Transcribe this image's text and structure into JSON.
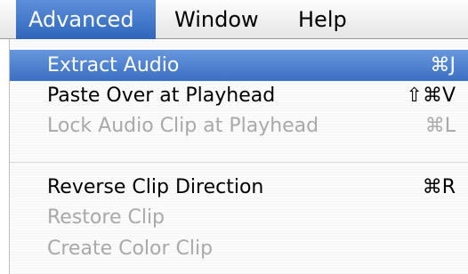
{
  "menubar": {
    "items": [
      {
        "label": "Advanced"
      },
      {
        "label": "Window"
      },
      {
        "label": "Help"
      }
    ]
  },
  "menu": {
    "items": [
      {
        "label": "Extract Audio",
        "shortcut": "⌘J"
      },
      {
        "label": "Paste Over at Playhead",
        "shortcut": "⇧⌘V"
      },
      {
        "label": "Lock Audio Clip at Playhead",
        "shortcut": "⌘L"
      },
      {
        "label": "Reverse Clip Direction",
        "shortcut": "⌘R"
      },
      {
        "label": "Restore Clip",
        "shortcut": ""
      },
      {
        "label": "Create Color Clip",
        "shortcut": ""
      }
    ]
  },
  "colors": {
    "highlight": "#3a6fc3",
    "disabled_text": "#a9a9a9"
  }
}
